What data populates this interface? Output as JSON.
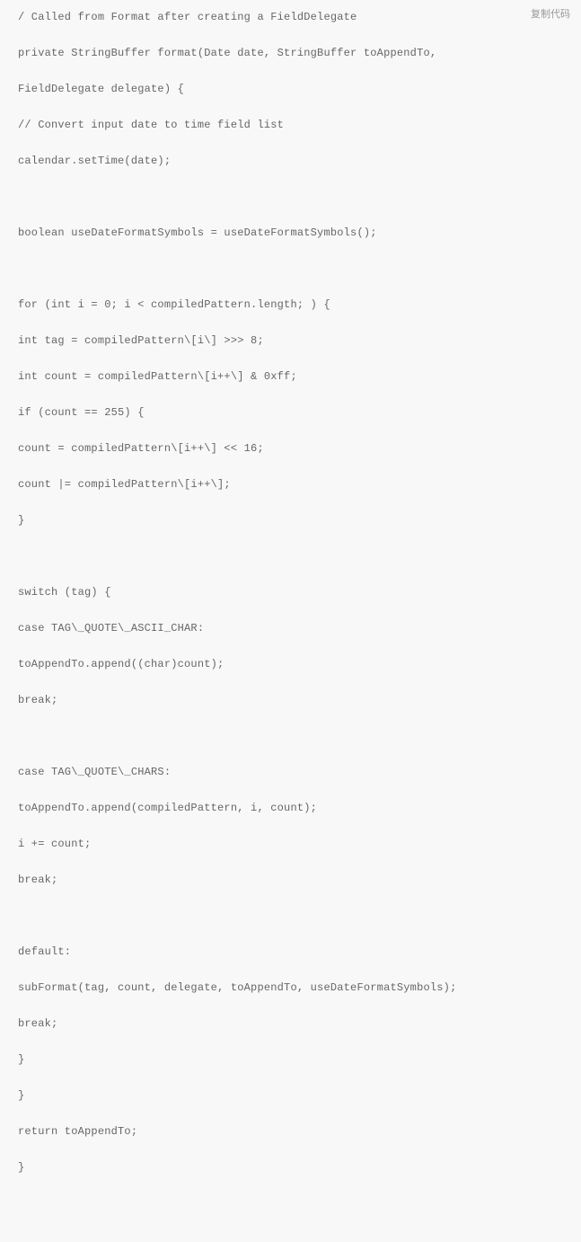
{
  "copy_label": "复制代码",
  "code_lines": [
    "/ Called from Format after creating a FieldDelegate",
    "private StringBuffer format(Date date, StringBuffer toAppendTo,",
    "FieldDelegate delegate) {",
    "// Convert input date to time field list",
    "calendar.setTime(date);",
    "",
    "boolean useDateFormatSymbols = useDateFormatSymbols();",
    "",
    "for (int i = 0; i < compiledPattern.length; ) {",
    "int tag = compiledPattern\\[i\\] >>> 8;",
    "int count = compiledPattern\\[i++\\] & 0xff;",
    "if (count == 255) {",
    "count = compiledPattern\\[i++\\] << 16;",
    "count |= compiledPattern\\[i++\\];",
    "}",
    "",
    "switch (tag) {",
    "case TAG\\_QUOTE\\_ASCII_CHAR:",
    "toAppendTo.append((char)count);",
    "break;",
    "",
    "case TAG\\_QUOTE\\_CHARS:",
    "toAppendTo.append(compiledPattern, i, count);",
    "i += count;",
    "break;",
    "",
    "default:",
    "subFormat(tag, count, delegate, toAppendTo, useDateFormatSymbols);",
    "break;",
    "}",
    "}",
    "return toAppendTo;",
    "}"
  ]
}
